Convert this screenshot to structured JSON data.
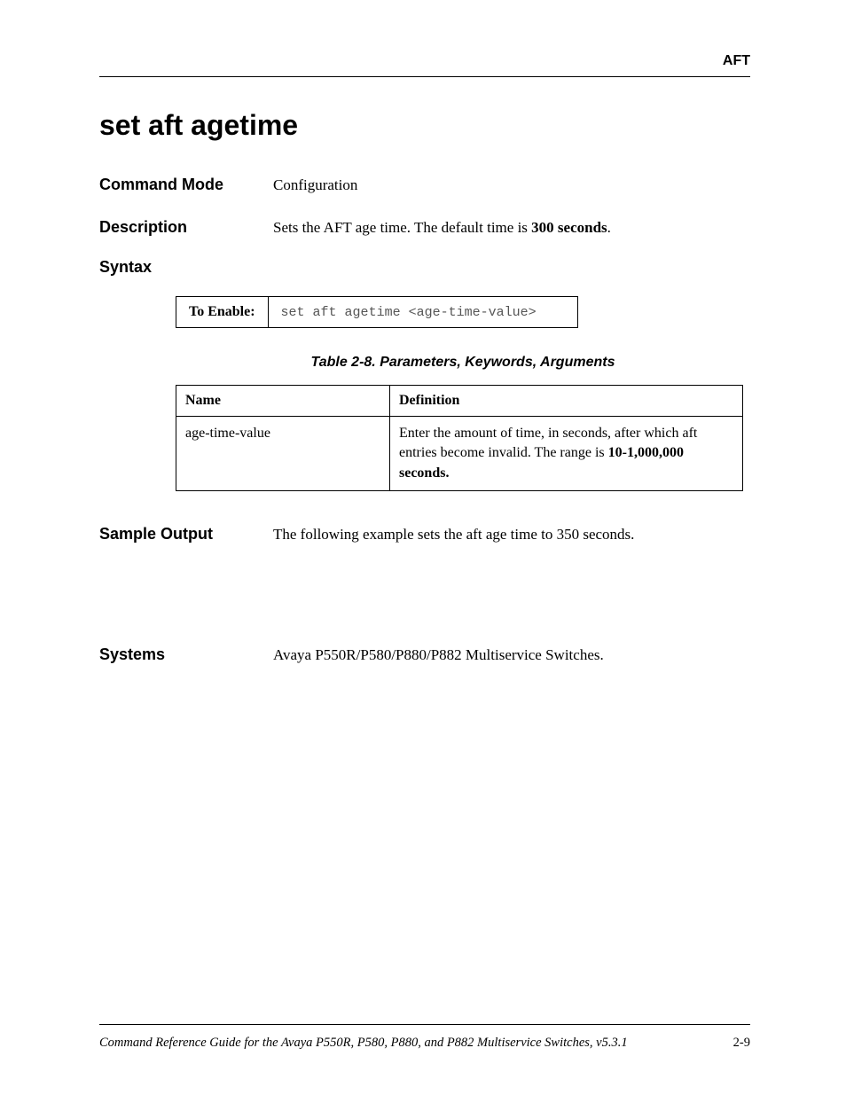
{
  "header": {
    "section": "AFT"
  },
  "title": "set aft agetime",
  "rows": {
    "command_mode": {
      "label": "Command Mode",
      "value": "Configuration"
    },
    "description": {
      "label": "Description",
      "prefix": "Sets the AFT age time. The default time is ",
      "bold": "300 seconds",
      "suffix": "."
    },
    "syntax": {
      "label": "Syntax"
    },
    "sample_output": {
      "label": "Sample Output",
      "value": "The following example sets the aft age time to 350 seconds."
    },
    "systems": {
      "label": "Systems",
      "value": "Avaya P550R/P580/P880/P882 Multiservice Switches."
    }
  },
  "syntax_table": {
    "enable_label": "To Enable:",
    "enable_cmd": "set aft agetime <age-time-value>"
  },
  "table_caption": "Table 2-8.  Parameters, Keywords, Arguments",
  "param_table": {
    "headers": {
      "name": "Name",
      "definition": "Definition"
    },
    "rows": [
      {
        "name": "age-time-value",
        "def_prefix": "Enter the amount of time, in seconds, after which aft entries become invalid. The range is ",
        "def_bold": "10-1,000,000 seconds."
      }
    ]
  },
  "footer": {
    "text": "Command Reference Guide for the Avaya P550R, P580, P880, and P882 Multiservice Switches, v5.3.1",
    "page": "2-9"
  }
}
